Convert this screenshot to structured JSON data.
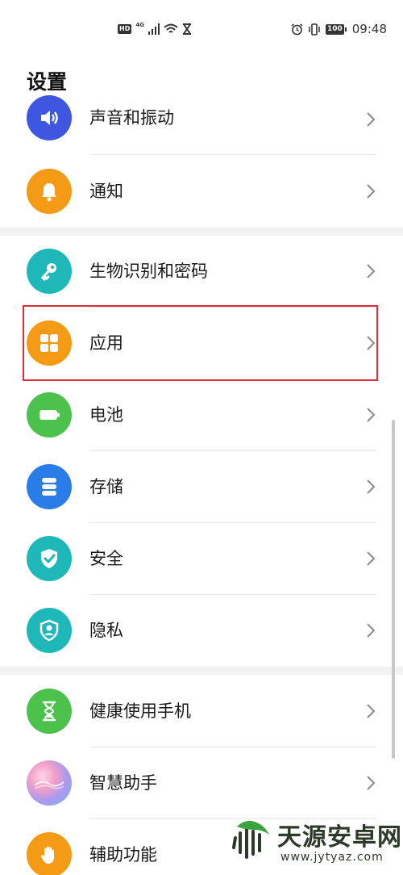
{
  "status_bar": {
    "hd": "HD",
    "network": "4G",
    "battery": "100",
    "time": "09:48"
  },
  "page": {
    "title": "设置"
  },
  "items": [
    {
      "label": "声音和振动",
      "icon": "speaker-icon",
      "color": "#3f57e0"
    },
    {
      "label": "通知",
      "icon": "bell-icon",
      "color": "#f59a14"
    },
    {
      "label": "生物识别和密码",
      "icon": "key-icon",
      "color": "#1fb8b8"
    },
    {
      "label": "应用",
      "icon": "apps-grid-icon",
      "color": "#f59a14"
    },
    {
      "label": "电池",
      "icon": "battery-icon",
      "color": "#4cc24c"
    },
    {
      "label": "存储",
      "icon": "storage-icon",
      "color": "#2a7de8"
    },
    {
      "label": "安全",
      "icon": "shield-check-icon",
      "color": "#1fb8b8"
    },
    {
      "label": "隐私",
      "icon": "privacy-shield-icon",
      "color": "#1fb8b8"
    },
    {
      "label": "健康使用手机",
      "icon": "hourglass-icon",
      "color": "#4cc24c"
    },
    {
      "label": "智慧助手",
      "icon": "assistant-orb-icon",
      "color": "#9b8be8"
    },
    {
      "label": "辅助功能",
      "icon": "hand-icon",
      "color": "#f59a14"
    }
  ],
  "watermark": {
    "text": "天源安卓网",
    "url": "www.jytyaz.com"
  }
}
